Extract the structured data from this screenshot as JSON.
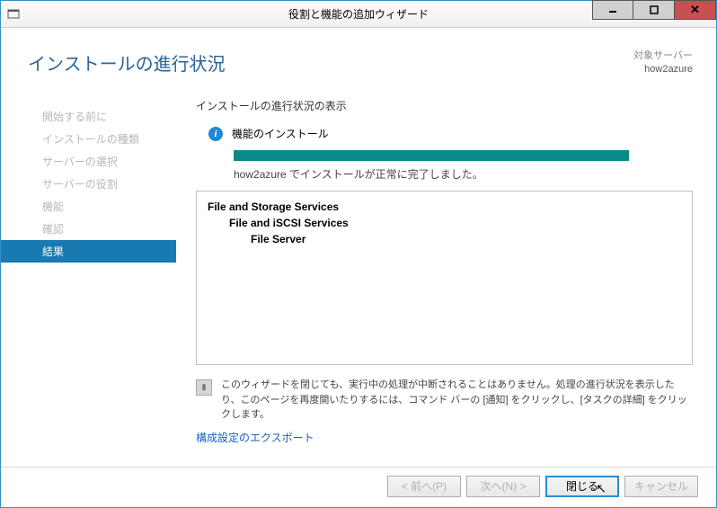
{
  "window": {
    "title": "役割と機能の追加ウィザード"
  },
  "header": {
    "page_title": "インストールの進行状況",
    "target_label": "対象サーバー",
    "target_name": "how2azure"
  },
  "sidebar": {
    "items": [
      "開始する前に",
      "インストールの種類",
      "サーバーの選択",
      "サーバーの役割",
      "機能",
      "確認",
      "結果"
    ],
    "active_index": 6
  },
  "main": {
    "heading": "インストールの進行状況の表示",
    "status_label": "機能のインストール",
    "progress_message": "how2azure でインストールが正常に完了しました。",
    "results": [
      {
        "level": 0,
        "text": "File and Storage Services"
      },
      {
        "level": 1,
        "text": "File and iSCSI Services"
      },
      {
        "level": 2,
        "text": "File Server"
      }
    ],
    "note": "このウィザードを閉じても、実行中の処理が中断されることはありません。処理の進行状況を表示したり、このページを再度開いたりするには、コマンド バーの [通知] をクリックし、[タスクの詳細] をクリックします。",
    "export_link": "構成設定のエクスポート"
  },
  "footer": {
    "prev": "< 前へ(P)",
    "next": "次へ(N) >",
    "close": "閉じる",
    "cancel": "キャンセル"
  }
}
